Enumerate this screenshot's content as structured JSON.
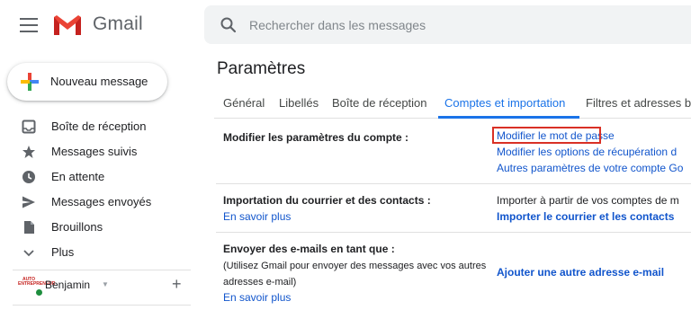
{
  "header": {
    "app_name": "Gmail",
    "search_placeholder": "Rechercher dans les messages"
  },
  "sidebar": {
    "compose_label": "Nouveau message",
    "items": [
      {
        "label": "Boîte de réception",
        "icon": "inbox-icon"
      },
      {
        "label": "Messages suivis",
        "icon": "star-icon"
      },
      {
        "label": "En attente",
        "icon": "clock-icon"
      },
      {
        "label": "Messages envoyés",
        "icon": "send-icon"
      },
      {
        "label": "Brouillons",
        "icon": "draft-icon"
      },
      {
        "label": "Plus",
        "icon": "chevron-down-icon"
      }
    ],
    "user": {
      "name": "Benjamin",
      "avatar_text": "AUTO ENTREPRENEUR"
    }
  },
  "main": {
    "title": "Paramètres",
    "tabs": [
      {
        "label": "Général",
        "active": false
      },
      {
        "label": "Libellés",
        "active": false
      },
      {
        "label": "Boîte de réception",
        "active": false
      },
      {
        "label": "Comptes et importation",
        "active": true
      },
      {
        "label": "Filtres et adresses b",
        "active": false
      }
    ],
    "sections": {
      "account": {
        "label": "Modifier les paramètres du compte :",
        "links": [
          "Modifier le mot de passe",
          "Modifier les options de récupération d",
          "Autres paramètres de votre compte Go"
        ]
      },
      "import": {
        "label": "Importation du courrier et des contacts :",
        "learn_more": "En savoir plus",
        "text": "Importer à partir de vos comptes de m",
        "action": "Importer le courrier et les contacts"
      },
      "send_as": {
        "label": "Envoyer des e-mails en tant que :",
        "note": "(Utilisez Gmail pour envoyer des messages avec vos autres adresses e-mail)",
        "learn_more": "En savoir plus",
        "action": "Ajouter une autre adresse e-mail"
      }
    }
  },
  "colors": {
    "link": "#1155cc",
    "accent": "#1a73e8",
    "highlight": "#d93025",
    "presence": "#1e8e3e"
  }
}
